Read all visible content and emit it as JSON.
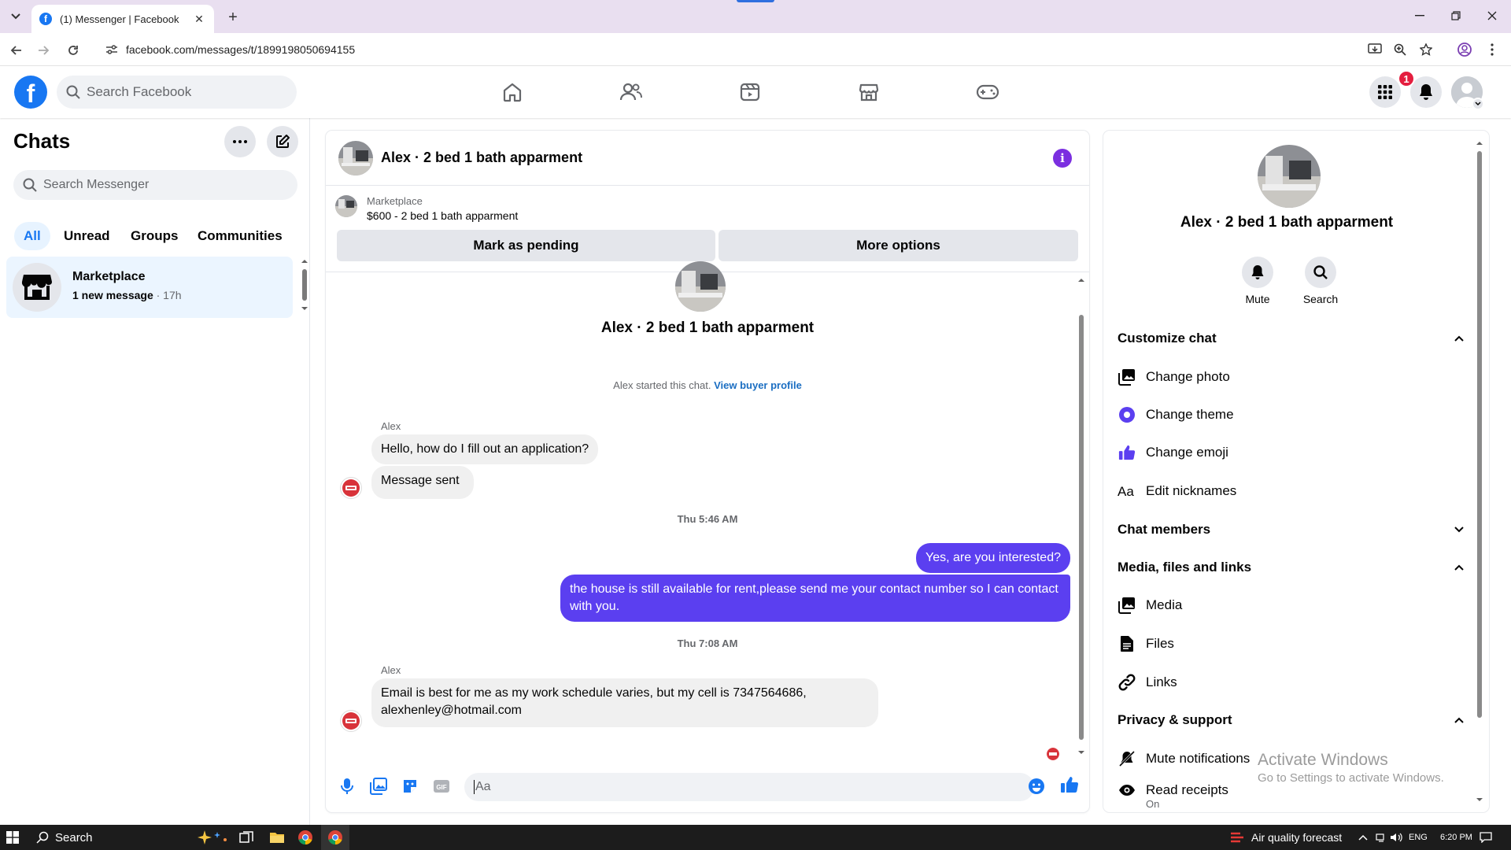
{
  "browser": {
    "tab_title": "(1) Messenger | Facebook",
    "url": "facebook.com/messages/t/1899198050694155"
  },
  "header": {
    "search_placeholder": "Search Facebook",
    "notification_count": "1"
  },
  "chats": {
    "title": "Chats",
    "search_placeholder": "Search Messenger",
    "filters": [
      "All",
      "Unread",
      "Groups",
      "Communities"
    ],
    "active_filter": "All",
    "items": [
      {
        "name": "Marketplace",
        "preview": "1 new message",
        "time": "· 17h"
      }
    ]
  },
  "conversation": {
    "title": "Alex · 2 bed 1 bath apparment",
    "marketplace_label": "Marketplace",
    "listing": "$600 - 2 bed 1 bath apparment",
    "mark_pending": "Mark as pending",
    "more_options": "More options",
    "center_name": "Alex · 2 bed 1 bath apparment",
    "system_text": "Alex started this chat.",
    "system_link": "View buyer profile",
    "messages": [
      {
        "sender": "Alex",
        "direction": "in",
        "text": "Hello, how do I fill out an application?"
      },
      {
        "direction": "in",
        "text": "Message sent"
      },
      {
        "separator": "Thu 5:46 AM"
      },
      {
        "direction": "out",
        "text": "Yes, are you interested?"
      },
      {
        "direction": "out",
        "text": "the house is still available for rent,please send me your contact number so I can contact with you."
      },
      {
        "separator": "Thu 7:08 AM"
      },
      {
        "sender": "Alex",
        "direction": "in",
        "text": "Email is best for me as my work schedule varies, but my cell is 7347564686, alexhenley@hotmail.com"
      }
    ],
    "composer_placeholder": "Aa",
    "accent_color": "#5b3ff0"
  },
  "info_panel": {
    "name": "Alex · 2 bed 1 bath apparment",
    "actions": [
      {
        "label": "Mute",
        "icon": "bell-icon"
      },
      {
        "label": "Search",
        "icon": "search-icon"
      }
    ],
    "customize_chat": "Customize chat",
    "customize_items": [
      {
        "label": "Change photo",
        "icon": "image-icon"
      },
      {
        "label": "Change theme",
        "icon": "theme-icon"
      },
      {
        "label": "Change emoji",
        "icon": "thumbs-up-icon"
      },
      {
        "label": "Edit nicknames",
        "icon": "text-aa-icon"
      }
    ],
    "chat_members": "Chat members",
    "media_section": "Media, files and links",
    "media_items": [
      {
        "label": "Media",
        "icon": "image-icon"
      },
      {
        "label": "Files",
        "icon": "file-icon"
      },
      {
        "label": "Links",
        "icon": "link-icon"
      }
    ],
    "privacy_section": "Privacy & support",
    "privacy_items": [
      {
        "label": "Mute notifications",
        "icon": "bell-off-icon"
      },
      {
        "label": "Read receipts",
        "icon": "eye-icon",
        "sub": "On"
      }
    ]
  },
  "watermark": {
    "title": "Activate Windows",
    "subtitle": "Go to Settings to activate Windows."
  },
  "taskbar": {
    "search": "Search",
    "weather": "Air quality forecast",
    "lang": "ENG",
    "time": "6:20 PM"
  }
}
